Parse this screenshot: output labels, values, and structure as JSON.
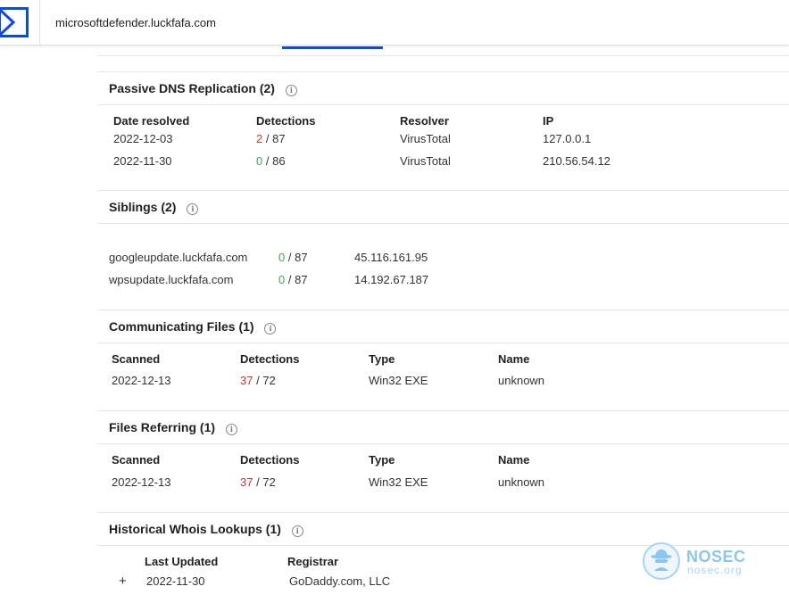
{
  "header": {
    "domain": "microsoftdefender.luckfafa.com",
    "logo_icon": "virustotal-logo-icon",
    "accent": "#0b4dda"
  },
  "info_icon_glyph": "i",
  "passive_dns": {
    "title": "Passive DNS Replication (2)",
    "columns": [
      "Date resolved",
      "Detections",
      "Resolver",
      "IP"
    ],
    "rows": [
      {
        "date": "2022-12-03",
        "det_hit": "2",
        "det_total": "/ 87",
        "resolver": "VirusTotal",
        "ip": "127.0.0.1"
      },
      {
        "date": "2022-11-30",
        "det_hit": "0",
        "det_total": "/ 86",
        "resolver": "VirusTotal",
        "ip": "210.56.54.12"
      }
    ]
  },
  "siblings": {
    "title": "Siblings (2)",
    "rows": [
      {
        "domain": "googleupdate.luckfafa.com",
        "det_hit": "0",
        "det_total": "/ 87",
        "ip": "45.116.161.95"
      },
      {
        "domain": "wpsupdate.luckfafa.com",
        "det_hit": "0",
        "det_total": "/ 87",
        "ip": "14.192.67.187"
      }
    ]
  },
  "communicating_files": {
    "title": "Communicating Files (1)",
    "columns": [
      "Scanned",
      "Detections",
      "Type",
      "Name"
    ],
    "rows": [
      {
        "scanned": "2022-12-13",
        "det_hit": "37",
        "det_total": "/ 72",
        "type": "Win32 EXE",
        "name": "unknown"
      }
    ]
  },
  "files_referring": {
    "title": "Files Referring (1)",
    "columns": [
      "Scanned",
      "Detections",
      "Type",
      "Name"
    ],
    "rows": [
      {
        "scanned": "2022-12-13",
        "det_hit": "37",
        "det_total": "/ 72",
        "type": "Win32 EXE",
        "name": "unknown"
      }
    ]
  },
  "whois": {
    "title": "Historical Whois Lookups (1)",
    "columns": [
      "Last Updated",
      "Registrar"
    ],
    "rows": [
      {
        "expand": "+",
        "updated": "2022-11-30",
        "registrar": "GoDaddy.com, LLC"
      }
    ]
  },
  "watermark": {
    "brand": "NOSEC",
    "site": "nosec.org"
  },
  "colors": {
    "detection_positive": "#c0392b",
    "detection_clean": "#3aa757"
  }
}
